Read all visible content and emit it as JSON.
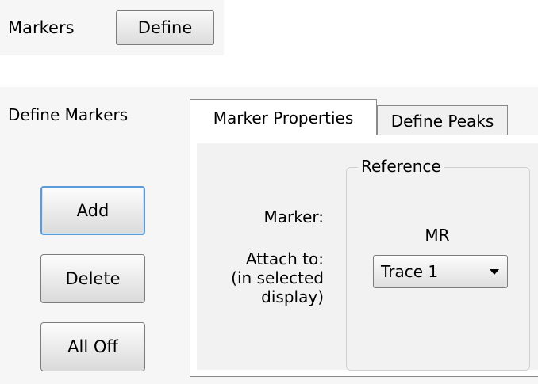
{
  "top": {
    "label": "Markers",
    "define_button": "Define"
  },
  "panel": {
    "title": "Define Markers",
    "buttons": {
      "add": "Add",
      "delete": "Delete",
      "all_off": "All Off"
    },
    "tabs": [
      {
        "label": "Marker Properties",
        "active": true
      },
      {
        "label": "Define Peaks",
        "active": false
      }
    ],
    "marker_properties": {
      "marker_label": "Marker:",
      "attach_label_line1": "Attach to:",
      "attach_label_line2": "(in selected",
      "attach_label_line3": "display)",
      "reference": {
        "title": "Reference",
        "marker_name": "MR",
        "attach_selected": "Trace 1"
      }
    }
  },
  "colors": {
    "focus_border": "#5a9bd8",
    "panel_background": "#f2f2f2"
  },
  "icons": {
    "dropdown": "chevron-down-icon"
  }
}
